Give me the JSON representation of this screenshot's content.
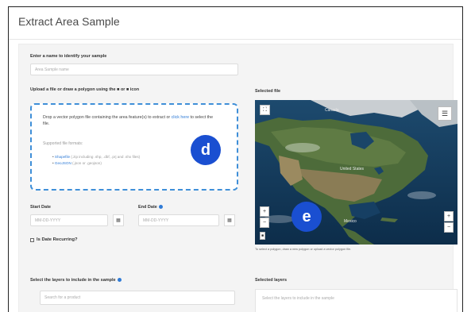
{
  "header": {
    "title": "Extract Area Sample"
  },
  "name_section": {
    "label": "Enter a name to identify your sample",
    "placeholder": "Area Sample name"
  },
  "upload": {
    "label": "Upload a file or draw a polygon using the ■ or ■ icon",
    "drop_text_1": "Drop a vector polygon file containing the area feature(s) to extract or",
    "drop_link": "click here",
    "drop_text_2": "to select the file.",
    "formats_label": "Supported file formats:",
    "formats": [
      {
        "name": "Shapefile",
        "note": "(.zip including .shp, .dbf, .prj and .shx files)"
      },
      {
        "name": "GeoJSON",
        "note": "(.json or .geojson)"
      }
    ]
  },
  "dates": {
    "start_label": "Start Date",
    "start_placeholder": "MM-DD-YYYY",
    "end_label": "End Date",
    "end_placeholder": "MM-DD-YYYY",
    "recurring_label": "Is Date Recurring?"
  },
  "selected_file": {
    "label": "Selected file",
    "map_labels": [
      "Canada",
      "United States",
      "Mexico"
    ],
    "caption": "To select a polygon, draw a new polygon or upload a vector polygon file."
  },
  "layers": {
    "label": "Select the layers to include in the sample",
    "search_placeholder": "Search for a product",
    "selected_label": "Selected layers",
    "selected_placeholder": "Select the layers to include in the sample"
  },
  "badges": {
    "upload": "d",
    "map": "e"
  },
  "colors": {
    "badge": "#1a4fd1",
    "accent": "#2f7bd6",
    "dashed_border": "#3f8fd8"
  }
}
